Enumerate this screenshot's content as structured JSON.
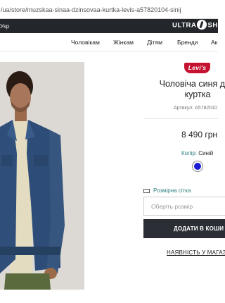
{
  "browser": {
    "url": "/ua/store/muzskaa-sinaa-dzinsovaa-kurtka-levis-a57820104-sinij"
  },
  "topbar": {
    "language": "Укр",
    "logo_left": "ULTRA",
    "logo_right": "SHO"
  },
  "nav": {
    "items": [
      "Чоловікам",
      "Жінкам",
      "Дітям",
      "Бренди",
      "Ак"
    ]
  },
  "product": {
    "brand": "Levi's",
    "title_line1": "Чоловіча синя джи",
    "title_line2": "куртка",
    "sku": "Артикул: A5782010",
    "price": "8 490 грн",
    "color_label": "Колір:",
    "color_value": "Синій",
    "swatch_color": "#1c1cd6",
    "size_grid": "Розмірна сітка",
    "size_placeholder": "Оберіть розмір",
    "buy_label": "ДОДАТИ В КОШИ",
    "stock_link": "НАЯВНІСТЬ У МАГАЗИ"
  }
}
